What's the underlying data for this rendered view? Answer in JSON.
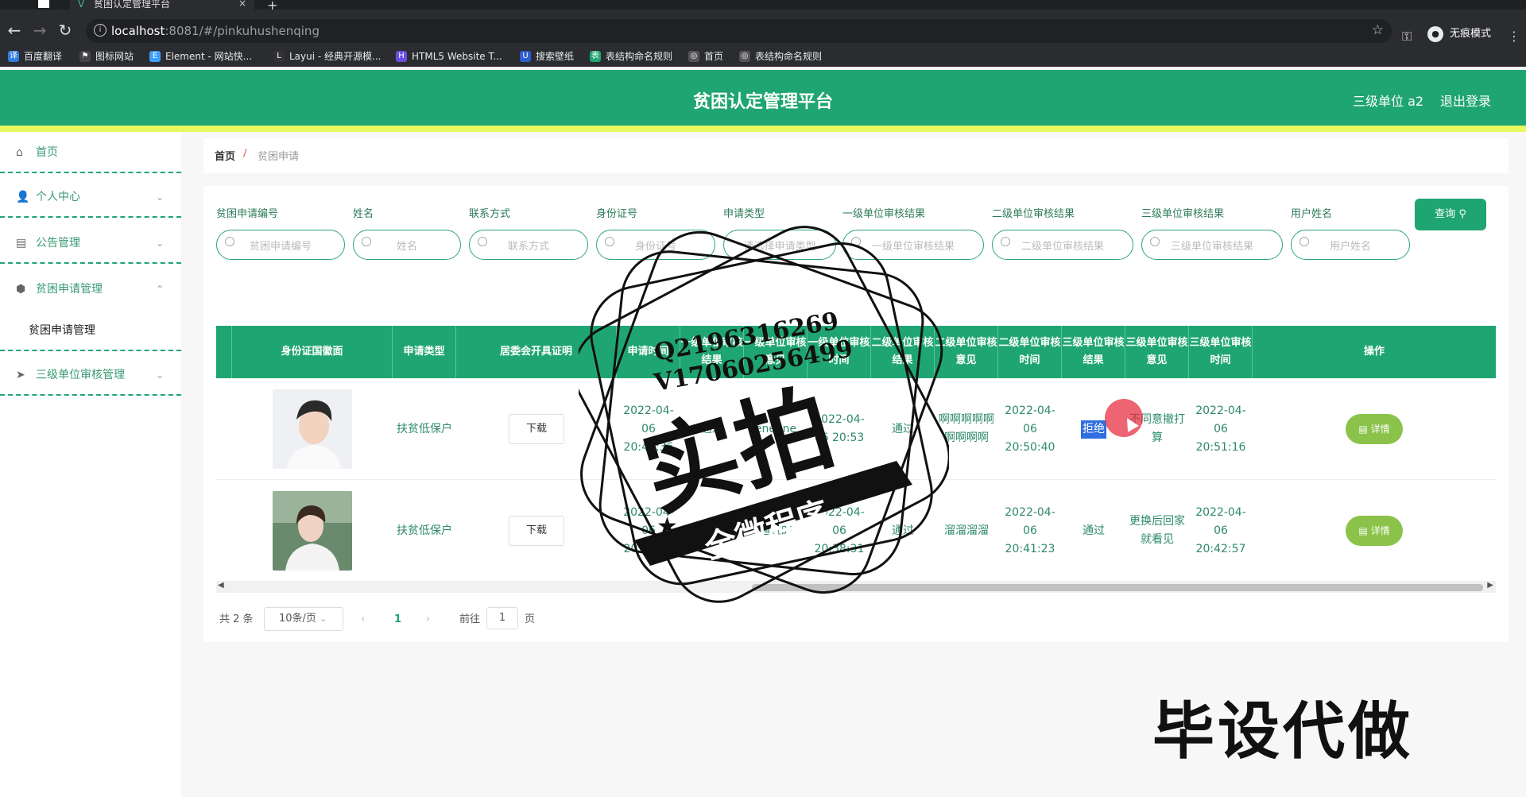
{
  "browser": {
    "tab_title": "贫困认定管理平台",
    "url_host": "localhost",
    "url_rest": ":8081/#/pinkuhushenqing",
    "incognito_label": "无痕模式",
    "bookmarks": [
      "百度翻译",
      "图标网站",
      "Element - 网站快...",
      "Layui - 经典开源模...",
      "HTML5 Website T...",
      "搜索壁纸",
      "表结构命名规则",
      "首页",
      "表结构命名规则"
    ]
  },
  "header": {
    "title": "贫困认定管理平台",
    "user": "三级单位 a2",
    "logout": "退出登录"
  },
  "sidebar": {
    "items": [
      {
        "label": "首页"
      },
      {
        "label": "个人中心"
      },
      {
        "label": "公告管理"
      },
      {
        "label": "贫困申请管理"
      },
      {
        "label": "三级单位审核管理"
      }
    ],
    "submenu": "贫困申请管理"
  },
  "breadcrumb": {
    "home": "首页",
    "sep": "/",
    "current": "贫困申请"
  },
  "filters": [
    {
      "label": "贫困申请编号",
      "placeholder": "贫困申请编号"
    },
    {
      "label": "姓名",
      "placeholder": "姓名"
    },
    {
      "label": "联系方式",
      "placeholder": "联系方式"
    },
    {
      "label": "身份证号",
      "placeholder": "身份证号"
    },
    {
      "label": "申请类型",
      "placeholder": "请选择申请类型"
    },
    {
      "label": "一级单位审核结果",
      "placeholder": "一级单位审核结果"
    },
    {
      "label": "二级单位审核结果",
      "placeholder": "二级单位审核结果"
    },
    {
      "label": "三级单位审核结果",
      "placeholder": "三级单位审核结果"
    },
    {
      "label": "用户姓名",
      "placeholder": "用户姓名"
    }
  ],
  "query_button": "查询",
  "table": {
    "headers": [
      "身份证国徽面",
      "申请类型",
      "居委会开具证明",
      "申请时间",
      "一级单位审核结果",
      "一级单位审核意见",
      "一级单位审核时间",
      "二级单位审核结果",
      "二级单位审核意见",
      "二级单位审核时间",
      "三级单位审核结果",
      "三级单位审核意见",
      "三级单位审核时间",
      "操作"
    ],
    "rows": [
      {
        "type": "扶贫低保户",
        "download": "下载",
        "apply_time": "2022-04-06 20:44:36",
        "l1_result": "通过",
        "l1_opinion": "eneene",
        "l1_time": "2022-04-06 20:53",
        "l2_result": "通过",
        "l2_opinion": "啊啊啊啊啊啊啊啊啊",
        "l2_time": "2022-04-06 20:50:40",
        "l3_result": "拒绝",
        "l3_opinion": "不同意撤打算",
        "l3_time": "2022-04-06 20:51:16",
        "action": "详情"
      },
      {
        "type": "扶贫低保户",
        "download": "下载",
        "apply_time": "2022-04-06 20:35:54",
        "l1_result": "通过",
        "l1_opinion": "通过的",
        "l1_time": "2022-04-06 20:38:31",
        "l2_result": "通过",
        "l2_opinion": "溜溜溜溜",
        "l2_time": "2022-04-06 20:41:23",
        "l3_result": "通过",
        "l3_opinion": "更换后回家就看见",
        "l3_time": "2022-04-06 20:42:57",
        "action": "详情"
      }
    ]
  },
  "pager": {
    "total": "共 2 条",
    "size": "10条/页",
    "page": "1",
    "goto": "前往",
    "page_input": "1",
    "page_unit": "页"
  },
  "watermark": {
    "qq": "Q2196316269",
    "v": "V17060256499",
    "big": "实拍",
    "ribbon": "全微程序",
    "corner": "毕设代做"
  },
  "colors": {
    "primary": "#1fa571",
    "accent_strip": "#e9f760",
    "detail_btn": "#8bc34a"
  }
}
